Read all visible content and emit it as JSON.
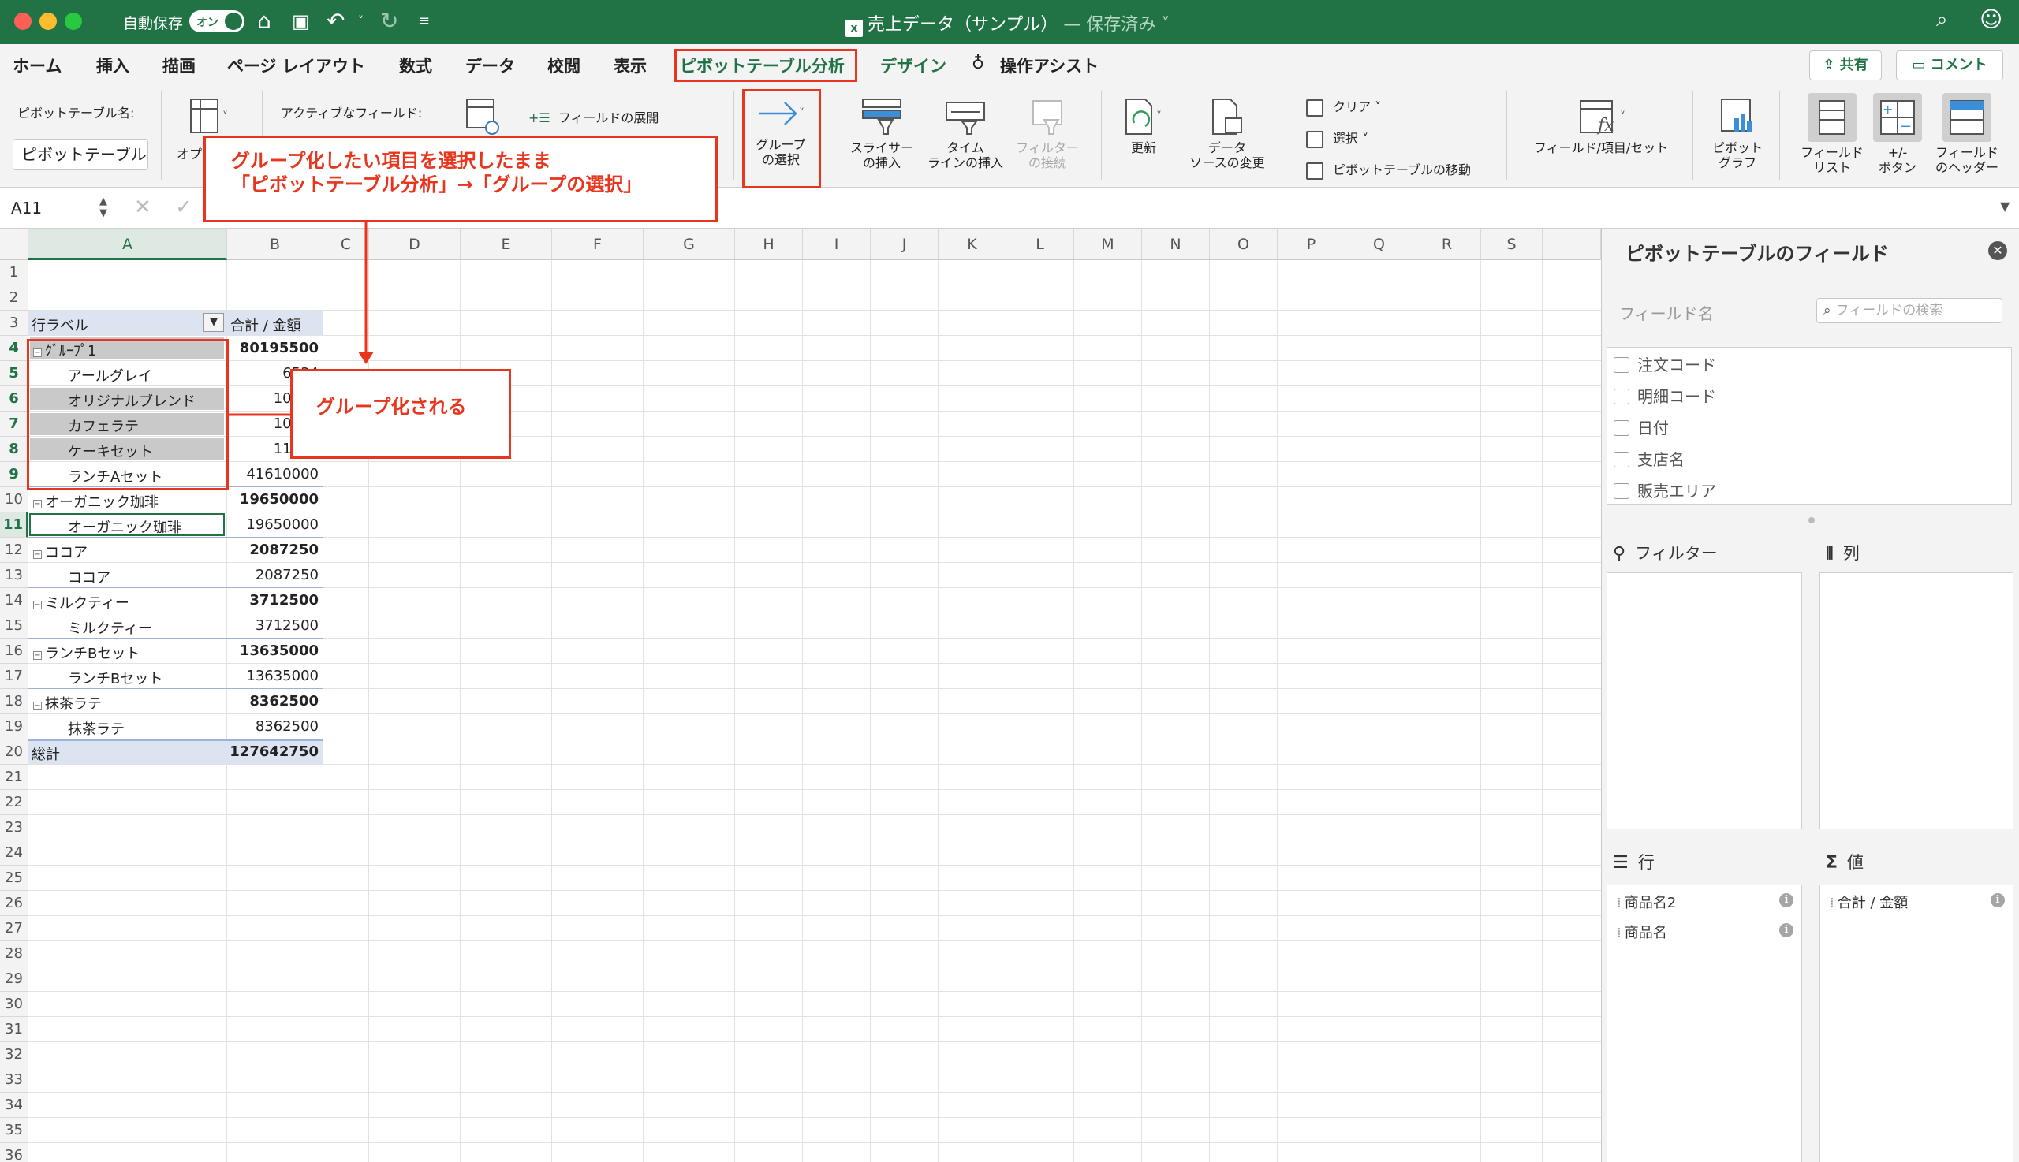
{
  "window": {
    "autosave_label": "自動保存",
    "autosave_state": "オン",
    "doc_title": "売上データ（サンプル）",
    "doc_status": "— 保存済み ˅"
  },
  "tabs": [
    {
      "label": "ホーム"
    },
    {
      "label": "挿入"
    },
    {
      "label": "描画"
    },
    {
      "label": "ページ レイアウト"
    },
    {
      "label": "数式"
    },
    {
      "label": "データ"
    },
    {
      "label": "校閲"
    },
    {
      "label": "表示"
    },
    {
      "label": "ピボットテーブル分析"
    },
    {
      "label": "デザイン"
    },
    {
      "label": "操作アシスト"
    }
  ],
  "share_label": "共有",
  "comment_label": "コメント",
  "ribbon": {
    "pt_name_label": "ピボットテーブル名:",
    "pt_name_value": "ピボットテーブル",
    "options_label": "オプ",
    "active_field_label": "アクティブなフィールド:",
    "expand_field_label": "フィールドの展開",
    "group_select": [
      "グループ",
      "の選択"
    ],
    "slicer": [
      "スライサー",
      "の挿入"
    ],
    "timeline": [
      "タイム",
      "ラインの挿入"
    ],
    "filter_conn": [
      "フィルター",
      "の接続"
    ],
    "refresh": "更新",
    "change_source": [
      "データ",
      "ソースの変更"
    ],
    "clear": "クリア ˅",
    "select": "選択 ˅",
    "move_pt": "ピボットテーブルの移動",
    "fields_items_sets": "フィールド/項目/セット",
    "pivot_chart": [
      "ピボット",
      "グラフ"
    ],
    "field_list": [
      "フィールド",
      "リスト"
    ],
    "plus_minus": [
      "+/-",
      "ボタン"
    ],
    "field_headers": [
      "フィールド",
      "のヘッダー"
    ]
  },
  "formula_bar": {
    "name_box": "A11"
  },
  "sheet": {
    "columns": [
      "A",
      "B",
      "C",
      "D",
      "E",
      "F",
      "G",
      "H",
      "I",
      "J",
      "K",
      "L",
      "M",
      "N",
      "O",
      "P",
      "Q",
      "R",
      "S"
    ],
    "rows": [
      "1",
      "2",
      "3",
      "4",
      "5",
      "6",
      "7",
      "8",
      "9",
      "10",
      "11",
      "12",
      "13",
      "14",
      "15",
      "16",
      "17",
      "18",
      "19",
      "20",
      "21",
      "22",
      "23",
      "24",
      "25",
      "26",
      "27",
      "28",
      "29",
      "30",
      "31",
      "32",
      "33",
      "34",
      "35",
      "36"
    ],
    "header_row_label": "行ラベル",
    "header_sum_label": "合計 / 金額",
    "cells": [
      {
        "row": 4,
        "a": "ｸﾞﾙｰﾌﾟ1",
        "b": "80195500",
        "level": 0,
        "bold": true,
        "gray": true
      },
      {
        "row": 5,
        "a": "アールグレイ",
        "b": "6534",
        "level": 1,
        "bold": false,
        "gray": false
      },
      {
        "row": 6,
        "a": "オリジナルブレンド",
        "b": "10620",
        "level": 1,
        "bold": false,
        "gray": true
      },
      {
        "row": 7,
        "a": "カフェラテ",
        "b": "10007",
        "level": 1,
        "bold": false,
        "gray": true
      },
      {
        "row": 8,
        "a": "ケーキセット",
        "b": "11424",
        "level": 1,
        "bold": false,
        "gray": true
      },
      {
        "row": 9,
        "a": "ランチAセット",
        "b": "41610000",
        "level": 1,
        "bold": false,
        "gray": false
      },
      {
        "row": 10,
        "a": "オーガニック珈琲",
        "b": "19650000",
        "level": 0,
        "bold": true,
        "gray": false
      },
      {
        "row": 11,
        "a": "オーガニック珈琲",
        "b": "19650000",
        "level": 1,
        "bold": false,
        "gray": false
      },
      {
        "row": 12,
        "a": "ココア",
        "b": "2087250",
        "level": 0,
        "bold": true,
        "gray": false
      },
      {
        "row": 13,
        "a": "ココア",
        "b": "2087250",
        "level": 1,
        "bold": false,
        "gray": false
      },
      {
        "row": 14,
        "a": "ミルクティー",
        "b": "3712500",
        "level": 0,
        "bold": true,
        "gray": false
      },
      {
        "row": 15,
        "a": "ミルクティー",
        "b": "3712500",
        "level": 1,
        "bold": false,
        "gray": false
      },
      {
        "row": 16,
        "a": "ランチBセット",
        "b": "13635000",
        "level": 0,
        "bold": true,
        "gray": false
      },
      {
        "row": 17,
        "a": "ランチBセット",
        "b": "13635000",
        "level": 1,
        "bold": false,
        "gray": false
      },
      {
        "row": 18,
        "a": "抹茶ラテ",
        "b": "8362500",
        "level": 0,
        "bold": true,
        "gray": false
      },
      {
        "row": 19,
        "a": "抹茶ラテ",
        "b": "8362500",
        "level": 1,
        "bold": false,
        "gray": false
      }
    ],
    "total_label": "総計",
    "total_value": "127642750"
  },
  "annotations": {
    "callout1": [
      "グループ化したい項目を選択したまま",
      "「ピボットテーブル分析」→「グループの選択」"
    ],
    "callout2": "グループ化される"
  },
  "fields_panel": {
    "title": "ピボットテーブルのフィールド",
    "field_name_label": "フィールド名",
    "search_placeholder": "フィールドの検索",
    "fields": [
      "注文コード",
      "明細コード",
      "日付",
      "支店名",
      "販売エリア"
    ],
    "filter_label": "フィルター",
    "columns_label": "列",
    "rows_label": "行",
    "values_label": "値",
    "row_items": [
      "商品名2",
      "商品名"
    ],
    "value_items": [
      "合計 / 金額"
    ]
  },
  "colors": {
    "excel_green": "#217346",
    "annotation_red": "#e8361e",
    "pivot_header_blue": "#dde4f1",
    "selection_gray": "#c9c9c9"
  }
}
